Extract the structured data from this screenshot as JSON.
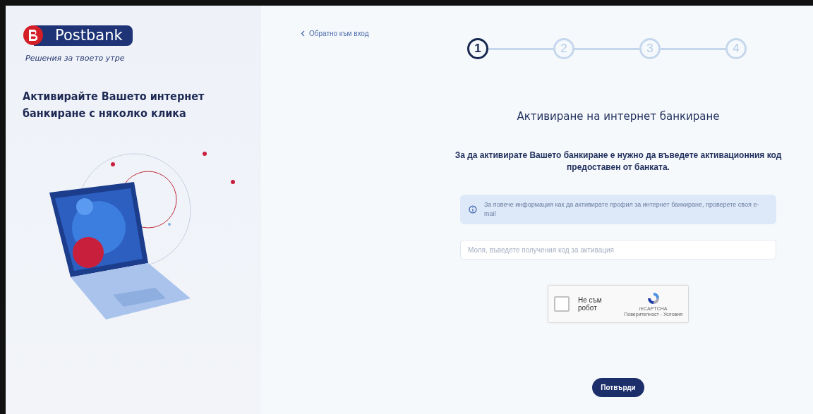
{
  "brand": {
    "name": "Postbank",
    "tagline": "Решения за твоето утре"
  },
  "promo": {
    "heading": "Активирайте Вашето интернет банкиране с няколко клика"
  },
  "back_link": {
    "label": "Обратно към вход"
  },
  "steps": [
    {
      "label": "1",
      "selected": true
    },
    {
      "label": "2",
      "selected": false
    },
    {
      "label": "3",
      "selected": false
    },
    {
      "label": "4",
      "selected": false
    }
  ],
  "form": {
    "title": "Активиране на интернет банкиране",
    "description": "За да активирате Вашето банкиране е нужно да въведете активационния код предоставен от банката.",
    "info": "За повече информация как да активирате профил за интернет банкиране, проверете своя e-mail",
    "code_field": {
      "placeholder": "Моля, въведете получения код за активация"
    },
    "captcha": {
      "label": "Не съм робот",
      "checked": false,
      "brand": "reCAPTCHA",
      "links": "Поверителност - Условия"
    },
    "submit": "Потвърди"
  }
}
